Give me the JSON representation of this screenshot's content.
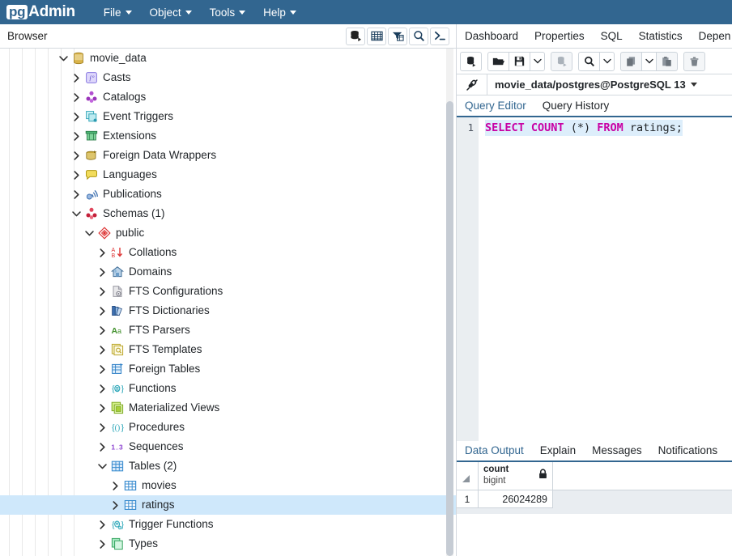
{
  "app": {
    "brand_pg": "pg",
    "brand_admin": "Admin",
    "menus": [
      {
        "label": "File"
      },
      {
        "label": "Object"
      },
      {
        "label": "Tools"
      },
      {
        "label": "Help"
      }
    ]
  },
  "browser": {
    "title": "Browser",
    "toolbar": [
      {
        "name": "add-server-icon",
        "title": "Add New Server"
      },
      {
        "name": "grid-icon",
        "title": "View Data"
      },
      {
        "name": "filter-icon",
        "title": "Filtered Rows"
      },
      {
        "name": "search-icon",
        "title": "Search Objects"
      },
      {
        "name": "terminal-icon",
        "title": "PSQL Tool"
      }
    ]
  },
  "tree": {
    "nodes": [
      {
        "label": "movie_data",
        "depth": 2,
        "expanded": true,
        "icon": "database-icon",
        "selected": false
      },
      {
        "label": "Casts",
        "depth": 3,
        "expanded": false,
        "icon": "casts-icon",
        "selected": false
      },
      {
        "label": "Catalogs",
        "depth": 3,
        "expanded": false,
        "icon": "catalogs-icon",
        "selected": false
      },
      {
        "label": "Event Triggers",
        "depth": 3,
        "expanded": false,
        "icon": "event-triggers-icon",
        "selected": false
      },
      {
        "label": "Extensions",
        "depth": 3,
        "expanded": false,
        "icon": "extensions-icon",
        "selected": false
      },
      {
        "label": "Foreign Data Wrappers",
        "depth": 3,
        "expanded": false,
        "icon": "fdw-icon",
        "selected": false
      },
      {
        "label": "Languages",
        "depth": 3,
        "expanded": false,
        "icon": "languages-icon",
        "selected": false
      },
      {
        "label": "Publications",
        "depth": 3,
        "expanded": false,
        "icon": "publications-icon",
        "selected": false
      },
      {
        "label": "Schemas (1)",
        "depth": 3,
        "expanded": true,
        "icon": "schemas-icon",
        "selected": false
      },
      {
        "label": "public",
        "depth": 4,
        "expanded": true,
        "icon": "schema-icon",
        "selected": false
      },
      {
        "label": "Collations",
        "depth": 5,
        "expanded": false,
        "icon": "collations-icon",
        "selected": false
      },
      {
        "label": "Domains",
        "depth": 5,
        "expanded": false,
        "icon": "domains-icon",
        "selected": false
      },
      {
        "label": "FTS Configurations",
        "depth": 5,
        "expanded": false,
        "icon": "fts-configurations-icon",
        "selected": false
      },
      {
        "label": "FTS Dictionaries",
        "depth": 5,
        "expanded": false,
        "icon": "fts-dictionaries-icon",
        "selected": false
      },
      {
        "label": "FTS Parsers",
        "depth": 5,
        "expanded": false,
        "icon": "fts-parsers-icon",
        "selected": false
      },
      {
        "label": "FTS Templates",
        "depth": 5,
        "expanded": false,
        "icon": "fts-templates-icon",
        "selected": false
      },
      {
        "label": "Foreign Tables",
        "depth": 5,
        "expanded": false,
        "icon": "foreign-tables-icon",
        "selected": false
      },
      {
        "label": "Functions",
        "depth": 5,
        "expanded": false,
        "icon": "functions-icon",
        "selected": false
      },
      {
        "label": "Materialized Views",
        "depth": 5,
        "expanded": false,
        "icon": "materialized-views-icon",
        "selected": false
      },
      {
        "label": "Procedures",
        "depth": 5,
        "expanded": false,
        "icon": "procedures-icon",
        "selected": false
      },
      {
        "label": "Sequences",
        "depth": 5,
        "expanded": false,
        "icon": "sequences-icon",
        "selected": false
      },
      {
        "label": "Tables (2)",
        "depth": 5,
        "expanded": true,
        "icon": "tables-icon",
        "selected": false
      },
      {
        "label": "movies",
        "depth": 6,
        "expanded": false,
        "icon": "table-icon",
        "selected": false
      },
      {
        "label": "ratings",
        "depth": 6,
        "expanded": false,
        "icon": "table-icon",
        "selected": true
      },
      {
        "label": "Trigger Functions",
        "depth": 5,
        "expanded": false,
        "icon": "trigger-functions-icon",
        "selected": false
      },
      {
        "label": "Types",
        "depth": 5,
        "expanded": false,
        "icon": "types-icon",
        "selected": false
      }
    ]
  },
  "right": {
    "object_tabs": [
      {
        "label": "Dashboard"
      },
      {
        "label": "Properties"
      },
      {
        "label": "SQL"
      },
      {
        "label": "Statistics"
      },
      {
        "label": "Depen"
      }
    ],
    "query_toolbar": [
      {
        "name": "open-connection-icon",
        "group": 0
      },
      {
        "name": "open-file-icon",
        "group": 1
      },
      {
        "name": "save-file-icon",
        "group": 1
      },
      {
        "name": "save-dropdown-icon",
        "group": 1
      },
      {
        "name": "edit-data-icon",
        "group": 2
      },
      {
        "name": "find-icon",
        "group": 3
      },
      {
        "name": "find-dropdown-icon",
        "group": 3
      },
      {
        "name": "copy-icon",
        "group": 4
      },
      {
        "name": "copy-dropdown-icon",
        "group": 4
      },
      {
        "name": "paste-icon",
        "group": 4
      },
      {
        "name": "delete-icon",
        "group": 5
      }
    ],
    "connection": {
      "icon": "connection-icon",
      "label": "movie_data/postgres@PostgreSQL 13"
    },
    "editor_tabs": [
      {
        "label": "Query Editor",
        "active": true
      },
      {
        "label": "Query History",
        "active": false
      }
    ],
    "editor": {
      "line_number": "1",
      "tokens": [
        {
          "text": "SELECT",
          "type": "keyword"
        },
        {
          "text": " ",
          "type": "plain"
        },
        {
          "text": "COUNT",
          "type": "keyword"
        },
        {
          "text": " (*) ",
          "type": "plain"
        },
        {
          "text": "FROM",
          "type": "keyword"
        },
        {
          "text": " ratings;",
          "type": "plain"
        }
      ]
    },
    "output_tabs": [
      {
        "label": "Data Output",
        "active": true
      },
      {
        "label": "Explain",
        "active": false
      },
      {
        "label": "Messages",
        "active": false
      },
      {
        "label": "Notifications",
        "active": false
      }
    ],
    "result_grid": {
      "columns": [
        {
          "name": "count",
          "type": "bigint",
          "locked": true,
          "lock_icon": "lock-icon"
        }
      ],
      "rows": [
        {
          "row_number": "1",
          "cells": [
            "26024289"
          ]
        }
      ]
    }
  },
  "colors": {
    "brand": "#326690",
    "selection": "#cfe8fb",
    "keyword": "#c800a4",
    "tab_active": "#326690"
  }
}
